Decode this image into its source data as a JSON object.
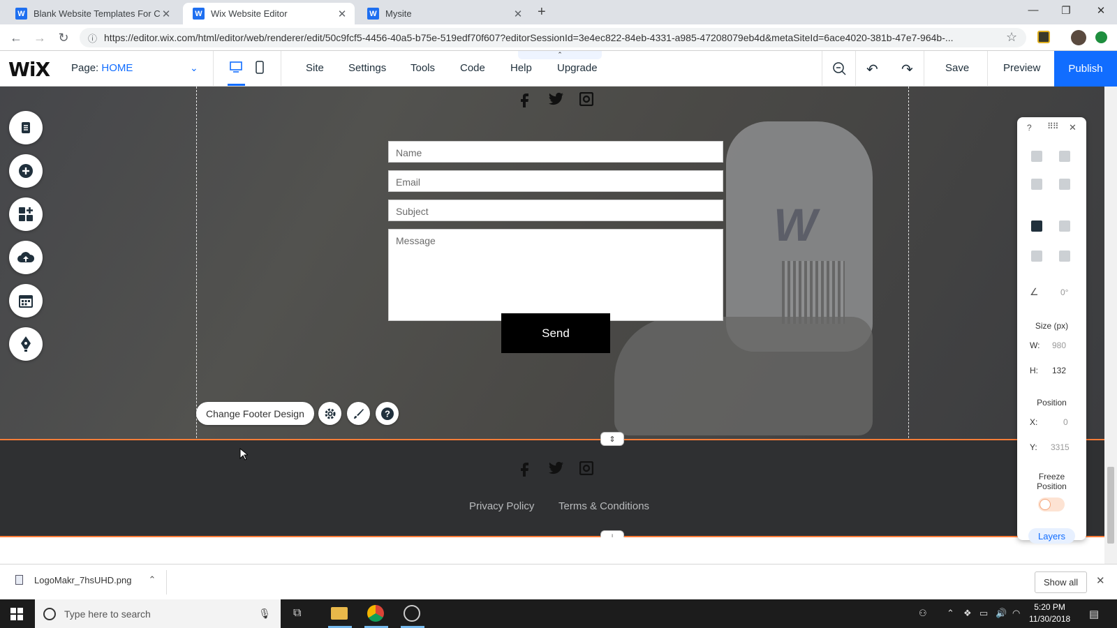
{
  "browser": {
    "tabs": [
      {
        "title": "Blank Website Templates For Cre",
        "active": false
      },
      {
        "title": "Wix Website Editor",
        "active": true
      },
      {
        "title": "Mysite",
        "active": false
      }
    ],
    "url": "https://editor.wix.com/html/editor/web/renderer/edit/50c9fcf5-4456-40a5-b75e-519edf70f607?editorSessionId=3e4ec822-84eb-4331-a985-47208079eb4d&metaSiteId=6ace4020-381b-47e7-964b-..."
  },
  "wix": {
    "logo": "WiX",
    "page_label": "Page:",
    "page_name": "HOME",
    "menu": [
      "Site",
      "Settings",
      "Tools",
      "Code",
      "Help",
      "Upgrade"
    ],
    "save": "Save",
    "preview": "Preview",
    "publish": "Publish",
    "accent": "#116dff"
  },
  "form": {
    "name_placeholder": "Name",
    "email_placeholder": "Email",
    "subject_placeholder": "Subject",
    "message_placeholder": "Message",
    "send_label": "Send"
  },
  "footer": {
    "change_design": "Change Footer Design",
    "privacy": "Privacy Policy",
    "terms": "Terms & Conditions",
    "selection_color": "#ff7d38"
  },
  "panel": {
    "help": "?",
    "rotation": "0°",
    "size_title": "Size (px)",
    "w_label": "W:",
    "w_value": "980",
    "h_label": "H:",
    "h_value": "132",
    "position_title": "Position",
    "x_label": "X:",
    "x_value": "0",
    "y_label": "Y:",
    "y_value": "3315",
    "freeze_label": "Freeze Position",
    "freeze_on": false,
    "layers": "Layers"
  },
  "downloads": {
    "file": "LogoMakr_7hsUHD.png",
    "show_all": "Show all"
  },
  "taskbar": {
    "search_placeholder": "Type here to search",
    "time": "5:20 PM",
    "date": "11/30/2018"
  }
}
